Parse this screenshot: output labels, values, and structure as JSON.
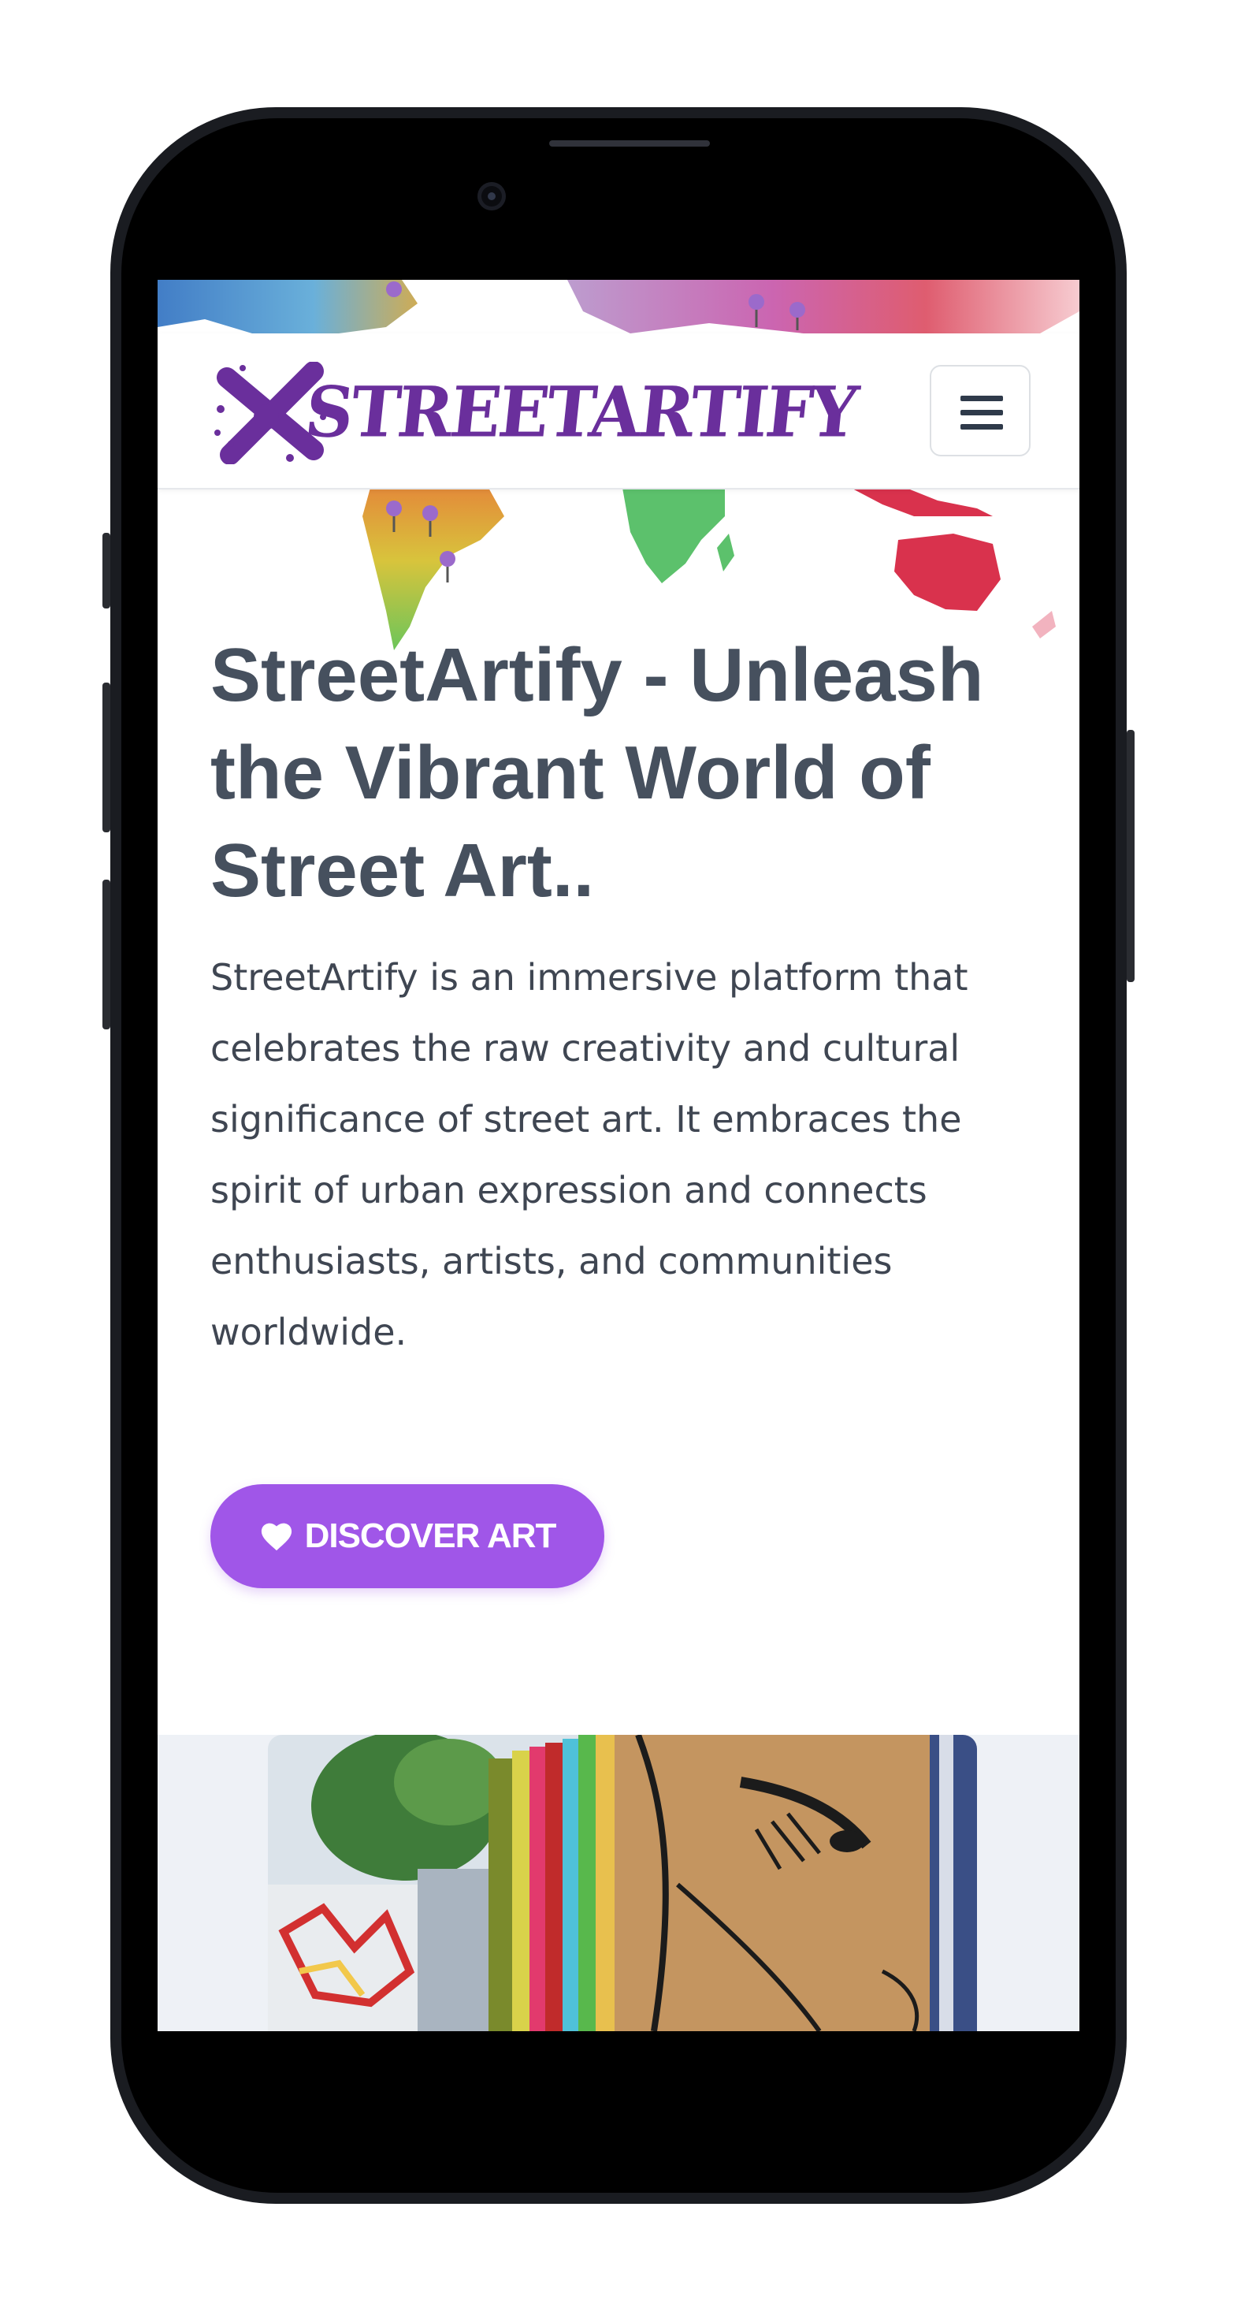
{
  "header": {
    "brand_text": "STREETARTIFY",
    "menu_icon": "hamburger-menu-icon"
  },
  "hero": {
    "title": "StreetArtify - Unleash the Vibrant World of Street Art..",
    "description": "StreetArtify is an immersive platform that celebrates the raw creativity and cultural significance of street art. It embraces the spirit of urban expression and connects enthusiasts, artists, and communities worldwide.",
    "cta_label": "DISCOVER ART",
    "cta_icon": "heart-icon"
  },
  "colors": {
    "accent": "#a056e8",
    "brand": "#6a2f9c",
    "title": "#46505e",
    "text": "#3f4652"
  }
}
